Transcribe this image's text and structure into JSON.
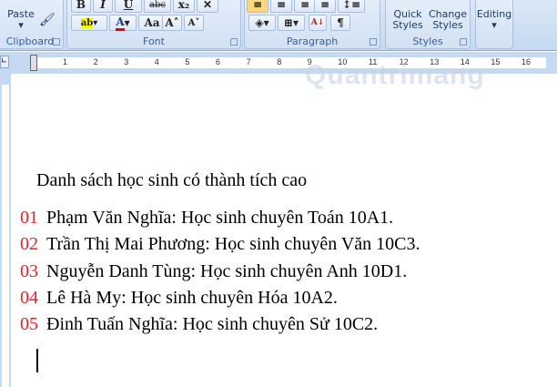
{
  "ribbon": {
    "clipboard": {
      "paste": "Paste",
      "label": "Clipboard"
    },
    "font": {
      "label": "Font",
      "bold": "B",
      "italic": "I",
      "underline": "U",
      "strike": "abc",
      "sub": "x₂",
      "clear": "✕",
      "grow": "A˄",
      "shrink": "A˅",
      "case": "Aa",
      "color_letter": "A",
      "highlight": "ab"
    },
    "paragraph": {
      "label": "Paragraph",
      "pilcrow": "¶",
      "sort": "A↓"
    },
    "styles": {
      "quick": "Quick Styles",
      "change": "Change Styles",
      "label": "Styles"
    },
    "editing": {
      "label": "Editing"
    }
  },
  "ruler": {
    "ticks": [
      "1",
      "2",
      "3",
      "4",
      "5",
      "6",
      "7",
      "8",
      "9",
      "10",
      "11",
      "12",
      "13",
      "14",
      "15",
      "16"
    ]
  },
  "watermark": "Quantrimang",
  "document": {
    "heading": "Danh sách học sinh có thành tích cao",
    "items": [
      {
        "num": "01",
        "text": "Phạm Văn Nghĩa: Học sinh chuyên Toán 10A1."
      },
      {
        "num": "02",
        "text": "Trần Thị Mai Phương: Học sinh chuyên Văn 10C3."
      },
      {
        "num": "03",
        "text": "Nguyễn Danh Tùng: Học sinh chuyên Anh 10D1."
      },
      {
        "num": "04",
        "text": "Lê Hà My: Học sinh chuyên Hóa 10A2."
      },
      {
        "num": "05",
        "text": "Đinh Tuấn Nghĩa: Học sinh chuyên Sử 10C2."
      }
    ]
  },
  "colors": {
    "number": "#e8202a",
    "ribbon": "#c5d9f1"
  }
}
